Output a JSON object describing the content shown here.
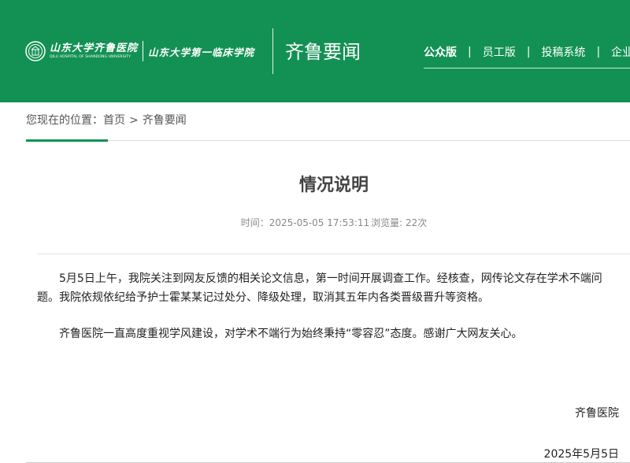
{
  "colors": {
    "brand_green": "#139154",
    "text_dark": "#222222",
    "meta_gray": "#888888"
  },
  "header": {
    "logo_cn_primary": "山东大学齐鲁医院",
    "logo_en": "QILU HOSPITAL OF SHANDONG UNIVERSITY",
    "logo_cn_secondary": "山东大学第一临床学院",
    "section_title": "齐鲁要闻",
    "nav": [
      {
        "label": "公众版",
        "active": true
      },
      {
        "label": "员工版",
        "active": false
      },
      {
        "label": "投稿系统",
        "active": false
      },
      {
        "label": "企业",
        "active": false
      }
    ]
  },
  "breadcrumb": {
    "prefix": "您现在的位置：",
    "home": "首页",
    "separator": ">",
    "current": "齐鲁要闻"
  },
  "article": {
    "title": "情况说明",
    "time_label": "时间：",
    "time_value": "2025-05-05 17:53:11",
    "views_label": "浏览量:",
    "views_value": "22次",
    "paragraphs": [
      "5月5日上午，我院关注到网友反馈的相关论文信息，第一时间开展调查工作。经核查，网传论文存在学术不端问题。我院依规依纪给予护士霍某某记过处分、降级处理，取消其五年内各类晋级晋升等资格。",
      "齐鲁医院一直高度重视学风建设，对学术不端行为始终秉持“零容忍”态度。感谢广大网友关心。"
    ],
    "signature": "齐鲁医院",
    "date": "2025年5月5日"
  },
  "icons": {
    "logo": "hospital-seal-icon"
  }
}
